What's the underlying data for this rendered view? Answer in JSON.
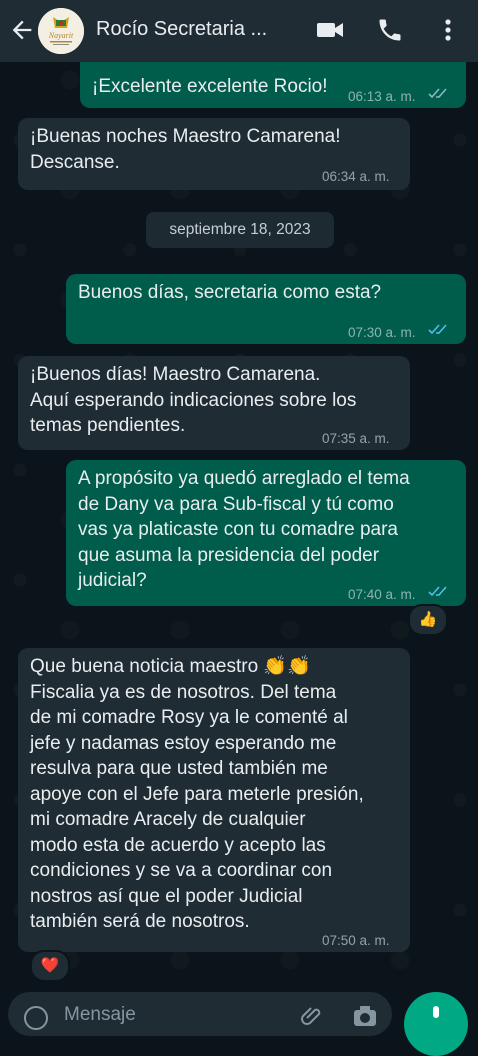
{
  "header": {
    "contact_name": "Rocío Secretaria ...",
    "avatar_logo_text": "Nayarit"
  },
  "messages": [
    {
      "dir": "out",
      "text": "¡Excelente excelente Rocio!",
      "time": "06:13 a. m.",
      "status": "read"
    },
    {
      "dir": "in",
      "text": "¡Buenas noches Maestro Camarena!\nDescanse.",
      "time": "06:34 a. m."
    },
    {
      "dir": "out",
      "text": "Buenos días, secretaria como esta?",
      "time": "07:30 a. m.",
      "status": "read"
    },
    {
      "dir": "in",
      "text": "¡Buenos días! Maestro Camarena.\nAquí esperando indicaciones sobre los\ntemas pendientes.",
      "time": "07:35 a. m."
    },
    {
      "dir": "out",
      "text": "A propósito ya quedó arreglado el tema\nde Dany va para Sub-fiscal y tú como\nvas ya platicaste con tu comadre para\nque asuma la presidencia del poder\njudicial?",
      "time": "07:40 a. m.",
      "status": "read"
    },
    {
      "dir": "in",
      "text": "Que buena noticia maestro 👏👏\nFiscalia ya es de nosotros. Del tema\nde mi comadre Rosy ya le comenté al\njefe y nadamas estoy esperando me\nresulva  para que usted también me\napoye con el Jefe para meterle presión,\nmi comadre Aracely de cualquier\nmodo esta de acuerdo y acepto las\ncondiciones y se va a coordinar con\nnostros así que el poder Judicial\ntambién será de nosotros.",
      "time": "07:50 a. m."
    }
  ],
  "date_separator": "septiembre 18, 2023",
  "reactions": [
    "👍",
    "❤️"
  ],
  "input": {
    "placeholder": "Mensaje"
  },
  "icons": [
    "back-arrow-icon",
    "video-call-icon",
    "phone-icon",
    "more-options-icon",
    "emoji-icon",
    "attach-icon",
    "camera-icon",
    "mic-icon"
  ],
  "colors": {
    "header_bg": "#1f2c34",
    "chat_bg": "#0b141a",
    "incoming_bubble": "#1f2c34",
    "outgoing_bubble": "#005c4b",
    "read_ticks": "#53bdeb",
    "accent": "#00a884"
  }
}
